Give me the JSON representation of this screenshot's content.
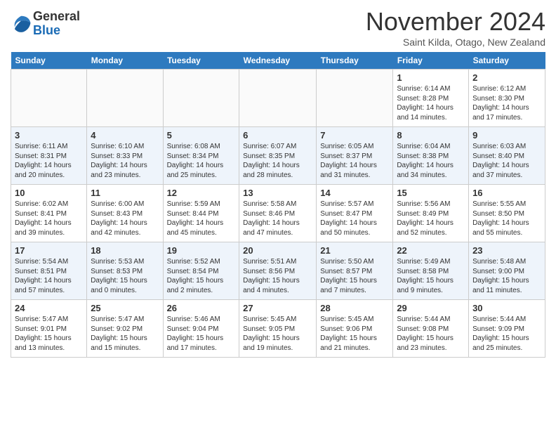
{
  "header": {
    "logo_general": "General",
    "logo_blue": "Blue",
    "month_title": "November 2024",
    "location": "Saint Kilda, Otago, New Zealand"
  },
  "weekdays": [
    "Sunday",
    "Monday",
    "Tuesday",
    "Wednesday",
    "Thursday",
    "Friday",
    "Saturday"
  ],
  "weeks": [
    [
      {
        "day": "",
        "info": ""
      },
      {
        "day": "",
        "info": ""
      },
      {
        "day": "",
        "info": ""
      },
      {
        "day": "",
        "info": ""
      },
      {
        "day": "",
        "info": ""
      },
      {
        "day": "1",
        "info": "Sunrise: 6:14 AM\nSunset: 8:28 PM\nDaylight: 14 hours and 14 minutes."
      },
      {
        "day": "2",
        "info": "Sunrise: 6:12 AM\nSunset: 8:30 PM\nDaylight: 14 hours and 17 minutes."
      }
    ],
    [
      {
        "day": "3",
        "info": "Sunrise: 6:11 AM\nSunset: 8:31 PM\nDaylight: 14 hours and 20 minutes."
      },
      {
        "day": "4",
        "info": "Sunrise: 6:10 AM\nSunset: 8:33 PM\nDaylight: 14 hours and 23 minutes."
      },
      {
        "day": "5",
        "info": "Sunrise: 6:08 AM\nSunset: 8:34 PM\nDaylight: 14 hours and 25 minutes."
      },
      {
        "day": "6",
        "info": "Sunrise: 6:07 AM\nSunset: 8:35 PM\nDaylight: 14 hours and 28 minutes."
      },
      {
        "day": "7",
        "info": "Sunrise: 6:05 AM\nSunset: 8:37 PM\nDaylight: 14 hours and 31 minutes."
      },
      {
        "day": "8",
        "info": "Sunrise: 6:04 AM\nSunset: 8:38 PM\nDaylight: 14 hours and 34 minutes."
      },
      {
        "day": "9",
        "info": "Sunrise: 6:03 AM\nSunset: 8:40 PM\nDaylight: 14 hours and 37 minutes."
      }
    ],
    [
      {
        "day": "10",
        "info": "Sunrise: 6:02 AM\nSunset: 8:41 PM\nDaylight: 14 hours and 39 minutes."
      },
      {
        "day": "11",
        "info": "Sunrise: 6:00 AM\nSunset: 8:43 PM\nDaylight: 14 hours and 42 minutes."
      },
      {
        "day": "12",
        "info": "Sunrise: 5:59 AM\nSunset: 8:44 PM\nDaylight: 14 hours and 45 minutes."
      },
      {
        "day": "13",
        "info": "Sunrise: 5:58 AM\nSunset: 8:46 PM\nDaylight: 14 hours and 47 minutes."
      },
      {
        "day": "14",
        "info": "Sunrise: 5:57 AM\nSunset: 8:47 PM\nDaylight: 14 hours and 50 minutes."
      },
      {
        "day": "15",
        "info": "Sunrise: 5:56 AM\nSunset: 8:49 PM\nDaylight: 14 hours and 52 minutes."
      },
      {
        "day": "16",
        "info": "Sunrise: 5:55 AM\nSunset: 8:50 PM\nDaylight: 14 hours and 55 minutes."
      }
    ],
    [
      {
        "day": "17",
        "info": "Sunrise: 5:54 AM\nSunset: 8:51 PM\nDaylight: 14 hours and 57 minutes."
      },
      {
        "day": "18",
        "info": "Sunrise: 5:53 AM\nSunset: 8:53 PM\nDaylight: 15 hours and 0 minutes."
      },
      {
        "day": "19",
        "info": "Sunrise: 5:52 AM\nSunset: 8:54 PM\nDaylight: 15 hours and 2 minutes."
      },
      {
        "day": "20",
        "info": "Sunrise: 5:51 AM\nSunset: 8:56 PM\nDaylight: 15 hours and 4 minutes."
      },
      {
        "day": "21",
        "info": "Sunrise: 5:50 AM\nSunset: 8:57 PM\nDaylight: 15 hours and 7 minutes."
      },
      {
        "day": "22",
        "info": "Sunrise: 5:49 AM\nSunset: 8:58 PM\nDaylight: 15 hours and 9 minutes."
      },
      {
        "day": "23",
        "info": "Sunrise: 5:48 AM\nSunset: 9:00 PM\nDaylight: 15 hours and 11 minutes."
      }
    ],
    [
      {
        "day": "24",
        "info": "Sunrise: 5:47 AM\nSunset: 9:01 PM\nDaylight: 15 hours and 13 minutes."
      },
      {
        "day": "25",
        "info": "Sunrise: 5:47 AM\nSunset: 9:02 PM\nDaylight: 15 hours and 15 minutes."
      },
      {
        "day": "26",
        "info": "Sunrise: 5:46 AM\nSunset: 9:04 PM\nDaylight: 15 hours and 17 minutes."
      },
      {
        "day": "27",
        "info": "Sunrise: 5:45 AM\nSunset: 9:05 PM\nDaylight: 15 hours and 19 minutes."
      },
      {
        "day": "28",
        "info": "Sunrise: 5:45 AM\nSunset: 9:06 PM\nDaylight: 15 hours and 21 minutes."
      },
      {
        "day": "29",
        "info": "Sunrise: 5:44 AM\nSunset: 9:08 PM\nDaylight: 15 hours and 23 minutes."
      },
      {
        "day": "30",
        "info": "Sunrise: 5:44 AM\nSunset: 9:09 PM\nDaylight: 15 hours and 25 minutes."
      }
    ]
  ]
}
